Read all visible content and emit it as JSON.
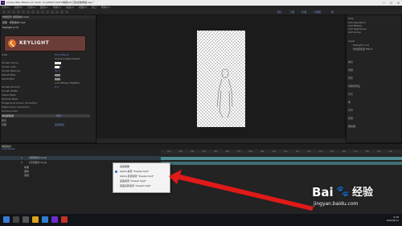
{
  "window": {
    "title": "Adobe After Effects CC 2018 - E:\\AE\\KEYLIGHT\\教程\\AE工程\\抠像教程.aep *",
    "app_badge": "Ae",
    "controls": [
      "—",
      "☐",
      "✕"
    ]
  },
  "menubar": {
    "items": [
      "文件(F)",
      "编辑(E)",
      "合成(C)",
      "图层(L)",
      "效果(T)",
      "动画(A)",
      "视图(V)",
      "窗口",
      "帮助(H)"
    ]
  },
  "toolbar": {
    "workspaces": [
      "默认",
      "了解",
      "标准",
      "小屏幕",
      "库"
    ]
  },
  "effects_panel": {
    "tab": "效果控件 绿幕素材.mp4",
    "layer": "抠像 · 绿幕素材.mp4",
    "effect_name": "Keylight (1.2)",
    "plugin_badge": "KEYLIGHT",
    "rows": [
      {
        "label": "View",
        "value": "Final Result"
      },
      {
        "label": "",
        "value": "Unpremultiply Result"
      },
      {
        "label": "Screen Colour",
        "value": ""
      },
      {
        "label": "Screen Gain",
        "value": "100.0"
      },
      {
        "label": "Screen Balance",
        "value": "50.0"
      },
      {
        "label": "Despill Bias",
        "value": ""
      },
      {
        "label": "Alpha Bias",
        "value": ""
      },
      {
        "label": "",
        "value": "Lock Biases Together"
      },
      {
        "label": "Screen Pre-blur",
        "value": "0.0"
      },
      {
        "label": "Screen Matte",
        "value": ""
      },
      {
        "label": "Inside Mask",
        "value": ""
      },
      {
        "label": "Outside Mask",
        "value": ""
      },
      {
        "label": "Foreground Colour Correction",
        "value": ""
      },
      {
        "label": "Edge Colour Correction",
        "value": ""
      },
      {
        "label": "Source Crops",
        "value": ""
      },
      {
        "label": "线性颜色键",
        "value": "重置"
      },
      {
        "label": "预览",
        "value": ""
      },
      {
        "label": "视图",
        "value": "最终输出"
      }
    ]
  },
  "right_panel": {
    "items": [
      "Flow",
      "Add Operators",
      "Add Effects",
      "Add Keyframes",
      "Add Group"
    ],
    "tree": [
      "Layer",
      "Keylight (1.2)",
      "线性颜色键 Effect"
    ],
    "sections": [
      "信息",
      "音频",
      "预览",
      "效果和预设",
      "对齐",
      "库",
      "字符",
      "段落",
      "跟踪器"
    ]
  },
  "timeline": {
    "tab": "绿幕素材",
    "timecode": "0;00;00;00",
    "layers": [
      {
        "num": "1",
        "name": "[绿幕素材.mp4]"
      },
      {
        "num": "2",
        "name": "[背景素材.mp4]"
      }
    ],
    "sub_rows": [
      "效果",
      "变换",
      "音频"
    ],
    "ruler_marks": [
      "01s",
      "02s",
      "03s",
      "04s",
      "05s",
      "06s",
      "07s",
      "08s",
      "09s",
      "10s",
      "11s",
      "12s",
      "13s",
      "14s",
      "15s",
      "16s",
      "17s",
      "18s",
      "19s",
      "20s"
    ]
  },
  "context_menu": {
    "items": [
      {
        "label": "亮度抠像",
        "checked": false
      },
      {
        "label": "Alpha 遮罩 \"trees2.mp4\"",
        "checked": true
      },
      {
        "label": "Alpha 反转遮罩 \"trees2.mp4\"",
        "checked": false
      },
      {
        "label": "亮度遮罩 \"trees2.mp4\"",
        "checked": false
      },
      {
        "label": "亮度反转遮罩 \"trees2.mp4\"",
        "checked": false
      }
    ]
  },
  "taskbar": {
    "time": "9:38",
    "date": "2020/8/11"
  },
  "watermark": {
    "brand": "Bai",
    "paw": "🐾",
    "jingyan": "经验",
    "url": "jingyan.baidu.com"
  },
  "colors": {
    "accent": "#4d8d92",
    "arrow": "#e01919",
    "badge_bg": "#6b3c38",
    "badge_circle": "#e8731d"
  }
}
